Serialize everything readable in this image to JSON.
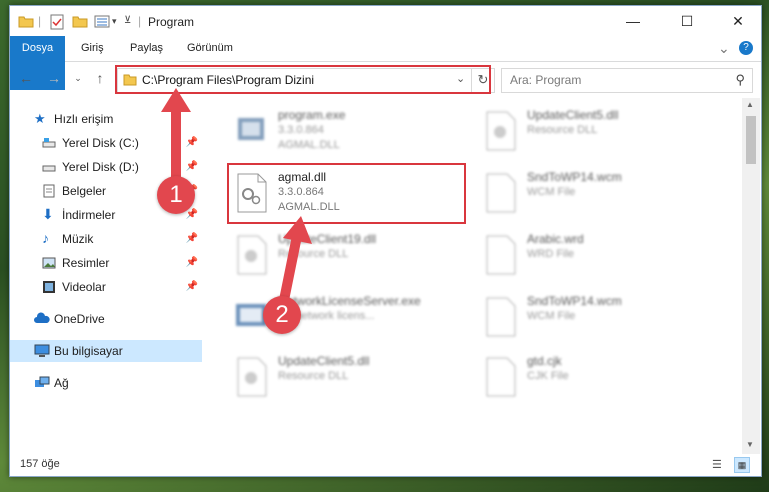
{
  "window": {
    "title": "Program",
    "quick_access_icons": [
      "folder-icon",
      "properties-icon",
      "new-folder-icon",
      "view-icon",
      "dropdown-icon"
    ],
    "controls": {
      "minimize": "—",
      "maximize": "☐",
      "close": "✕"
    }
  },
  "ribbon": {
    "tabs": [
      "Dosya",
      "Giriş",
      "Paylaş",
      "Görünüm"
    ],
    "collapse_symbol": "⌄",
    "help_symbol": "?"
  },
  "address": {
    "path": "C:\\Program Files\\Program Dizini",
    "search_placeholder": "Ara: Program"
  },
  "sidebar": {
    "quick_access": "Hızlı erişim",
    "items": [
      {
        "label": "Yerel Disk (C:)",
        "icon": "drive-icon",
        "pinned": true
      },
      {
        "label": "Yerel Disk (D:)",
        "icon": "drive-icon",
        "pinned": true
      },
      {
        "label": "Belgeler",
        "icon": "documents-icon",
        "pinned": true
      },
      {
        "label": "İndirmeler",
        "icon": "downloads-icon",
        "pinned": true
      },
      {
        "label": "Müzik",
        "icon": "music-icon",
        "pinned": true
      },
      {
        "label": "Resimler",
        "icon": "pictures-icon",
        "pinned": true
      },
      {
        "label": "Videolar",
        "icon": "videos-icon",
        "pinned": true
      }
    ],
    "onedrive": "OneDrive",
    "this_pc": "Bu bilgisayar",
    "network": "Ağ"
  },
  "files": [
    {
      "name": "program.exe",
      "line1": "3.3.0.864",
      "line2": "AGMAL.DLL",
      "blurred": true
    },
    {
      "name": "UpdateClient5.dll",
      "line1": "Resource DLL",
      "line2": "",
      "blurred": true
    },
    {
      "name": "agmal.dll",
      "line1": "3.3.0.864",
      "line2": "AGMAL.DLL",
      "blurred": false
    },
    {
      "name": "SndToWP14.wcm",
      "line1": "WCM File",
      "line2": "",
      "blurred": true
    },
    {
      "name": "UpdateClient19.dll",
      "line1": "Resource DLL",
      "line2": "",
      "blurred": true
    },
    {
      "name": "Arabic.wrd",
      "line1": "WRD File",
      "line2": "",
      "blurred": true
    },
    {
      "name": "NetworkLicenseServer.exe",
      "line1": "EY network licens...",
      "line2": "",
      "blurred": true
    },
    {
      "name": "SndToWP14.wcm",
      "line1": "WCM File",
      "line2": "",
      "blurred": true
    },
    {
      "name": "UpdateClient5.dll",
      "line1": "Resource DLL",
      "line2": "",
      "blurred": true
    },
    {
      "name": "gtd.cjk",
      "line1": "CJK File",
      "line2": "",
      "blurred": true
    }
  ],
  "status": {
    "count": "157 öğe"
  },
  "annotations": {
    "marker1": "1",
    "marker2": "2",
    "color": "#e2474e"
  }
}
